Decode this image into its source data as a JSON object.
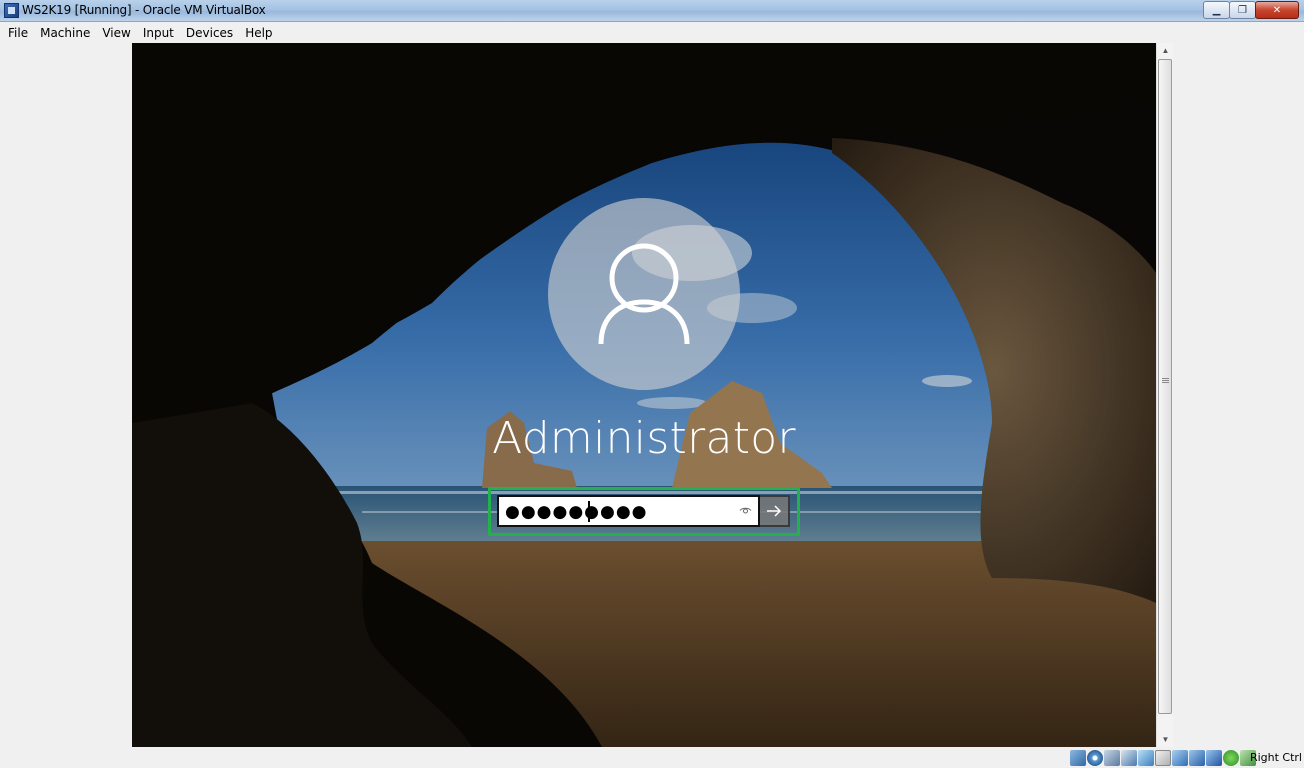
{
  "window": {
    "title": "WS2K19 [Running] - Oracle VM VirtualBox",
    "minimize_glyph": "▁",
    "maximize_glyph": "❐",
    "close_glyph": "✕"
  },
  "menu": {
    "items": [
      "File",
      "Machine",
      "View",
      "Input",
      "Devices",
      "Help"
    ]
  },
  "login": {
    "username": "Administrator",
    "password_masked": "●●●●●●●●●",
    "reveal_icon": "eye-icon",
    "submit_icon": "arrow-right-icon",
    "highlight_color": "#22b14c"
  },
  "statusbar": {
    "icons": [
      "hard-disk-icon",
      "optical-drive-icon",
      "audio-icon",
      "network-icon",
      "usb-icon",
      "shared-folders-icon",
      "display-icon",
      "recording-icon",
      "virtualization-icon",
      "mouse-integration-icon",
      "keyboard-icon"
    ],
    "host_key_label": "Right Ctrl"
  }
}
